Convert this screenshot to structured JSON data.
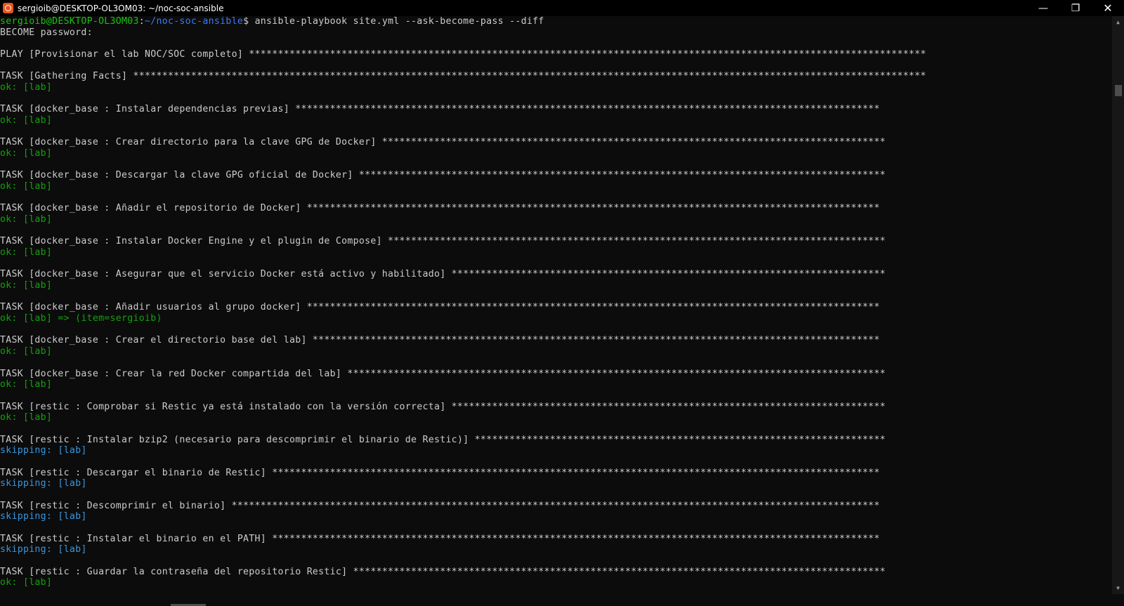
{
  "window": {
    "title": "sergioib@DESKTOP-OL3OM03: ~/noc-soc-ansible",
    "minimize_glyph": "—",
    "maximize_glyph": "❐",
    "close_glyph": "✕"
  },
  "colors": {
    "background": "#0c0c0c",
    "text": "#cccccc",
    "ok": "#13a10e",
    "skipping": "#3a96dd",
    "prompt_user": "#16c60c",
    "prompt_path": "#3b78ff"
  },
  "prompt": {
    "user_host": "sergioib@DESKTOP-OL3OM03",
    "separator": ":",
    "path": "~/noc-soc-ansible",
    "symbol": "$ ",
    "command": "ansible-playbook site.yml --ask-become-pass --diff"
  },
  "lines": [
    {
      "text": "BECOME password:",
      "color": "white"
    },
    {
      "text": "",
      "color": "white"
    },
    {
      "text": "PLAY [Provisionar el lab NOC/SOC completo] *********************************************************************************************************************",
      "color": "white"
    },
    {
      "text": "",
      "color": "white"
    },
    {
      "text": "TASK [Gathering Facts] *****************************************************************************************************************************************",
      "color": "white"
    },
    {
      "text": "ok: [lab]",
      "color": "green"
    },
    {
      "text": "",
      "color": "white"
    },
    {
      "text": "TASK [docker_base : Instalar dependencias previas] *****************************************************************************************************",
      "color": "white"
    },
    {
      "text": "ok: [lab]",
      "color": "green"
    },
    {
      "text": "",
      "color": "white"
    },
    {
      "text": "TASK [docker_base : Crear directorio para la clave GPG de Docker] ***************************************************************************************",
      "color": "white"
    },
    {
      "text": "ok: [lab]",
      "color": "green"
    },
    {
      "text": "",
      "color": "white"
    },
    {
      "text": "TASK [docker_base : Descargar la clave GPG oficial de Docker] *******************************************************************************************",
      "color": "white"
    },
    {
      "text": "ok: [lab]",
      "color": "green"
    },
    {
      "text": "",
      "color": "white"
    },
    {
      "text": "TASK [docker_base : Añadir el repositorio de Docker] ***************************************************************************************************",
      "color": "white"
    },
    {
      "text": "ok: [lab]",
      "color": "green"
    },
    {
      "text": "",
      "color": "white"
    },
    {
      "text": "TASK [docker_base : Instalar Docker Engine y el plugin de Compose] **************************************************************************************",
      "color": "white"
    },
    {
      "text": "ok: [lab]",
      "color": "green"
    },
    {
      "text": "",
      "color": "white"
    },
    {
      "text": "TASK [docker_base : Asegurar que el servicio Docker está activo y habilitado] ***************************************************************************",
      "color": "white"
    },
    {
      "text": "ok: [lab]",
      "color": "green"
    },
    {
      "text": "",
      "color": "white"
    },
    {
      "text": "TASK [docker_base : Añadir usuarios al grupo docker] ***************************************************************************************************",
      "color": "white"
    },
    {
      "text": "ok: [lab] => (item=sergioib)",
      "color": "green"
    },
    {
      "text": "",
      "color": "white"
    },
    {
      "text": "TASK [docker_base : Crear el directorio base del lab] **************************************************************************************************",
      "color": "white"
    },
    {
      "text": "ok: [lab]",
      "color": "green"
    },
    {
      "text": "",
      "color": "white"
    },
    {
      "text": "TASK [docker_base : Crear la red Docker compartida del lab] *********************************************************************************************",
      "color": "white"
    },
    {
      "text": "ok: [lab]",
      "color": "green"
    },
    {
      "text": "",
      "color": "white"
    },
    {
      "text": "TASK [restic : Comprobar si Restic ya está instalado con la versión correcta] ***************************************************************************",
      "color": "white"
    },
    {
      "text": "ok: [lab]",
      "color": "green"
    },
    {
      "text": "",
      "color": "white"
    },
    {
      "text": "TASK [restic : Instalar bzip2 (necesario para descomprimir el binario de Restic)] ***********************************************************************",
      "color": "white"
    },
    {
      "text": "skipping: [lab]",
      "color": "cyan"
    },
    {
      "text": "",
      "color": "white"
    },
    {
      "text": "TASK [restic : Descargar el binario de Restic] *********************************************************************************************************",
      "color": "white"
    },
    {
      "text": "skipping: [lab]",
      "color": "cyan"
    },
    {
      "text": "",
      "color": "white"
    },
    {
      "text": "TASK [restic : Descomprimir el binario] ****************************************************************************************************************",
      "color": "white"
    },
    {
      "text": "skipping: [lab]",
      "color": "cyan"
    },
    {
      "text": "",
      "color": "white"
    },
    {
      "text": "TASK [restic : Instalar el binario en el PATH] *********************************************************************************************************",
      "color": "white"
    },
    {
      "text": "skipping: [lab]",
      "color": "cyan"
    },
    {
      "text": "",
      "color": "white"
    },
    {
      "text": "TASK [restic : Guardar la contraseña del repositorio Restic] ********************************************************************************************",
      "color": "white"
    },
    {
      "text": "ok: [lab]",
      "color": "green"
    }
  ],
  "scrollbar": {
    "up_icon": "▲",
    "down_icon": "▼"
  }
}
